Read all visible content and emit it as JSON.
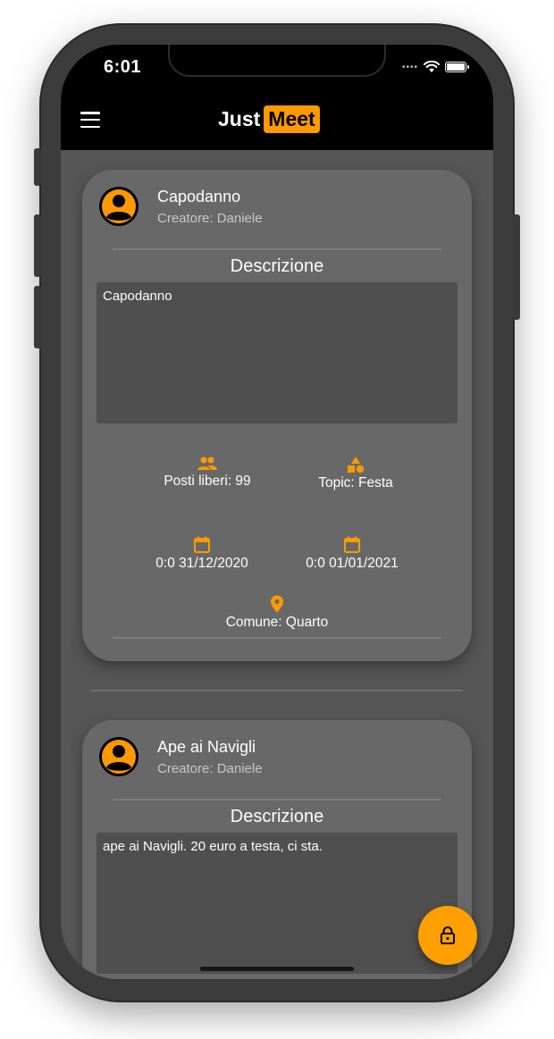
{
  "status_bar": {
    "time": "6:01"
  },
  "app_bar": {
    "logo_just": "Just",
    "logo_meet": "Meet"
  },
  "events": [
    {
      "title": "Capodanno",
      "creator": "Creatore: Daniele",
      "description_heading": "Descrizione",
      "description": "Capodanno",
      "seats": "Posti liberi: 99",
      "topic": "Topic: Festa",
      "start": "0:0 31/12/2020",
      "end": "0:0 01/01/2021",
      "municipality": "Comune: Quarto"
    },
    {
      "title": "Ape ai Navigli",
      "creator": "Creatore: Daniele",
      "description_heading": "Descrizione",
      "description": "ape ai Navigli. 20 euro a testa, ci sta."
    }
  ],
  "colors": {
    "accent": "#ff9900",
    "appbar": "#000000",
    "background": "#565656",
    "card": "#686868"
  },
  "icons": {
    "menu": "menu-icon",
    "seats": "people-icon",
    "topic": "category-shapes-icon",
    "date": "calendar-icon",
    "location": "location-pin-icon",
    "fab": "lock-icon"
  }
}
